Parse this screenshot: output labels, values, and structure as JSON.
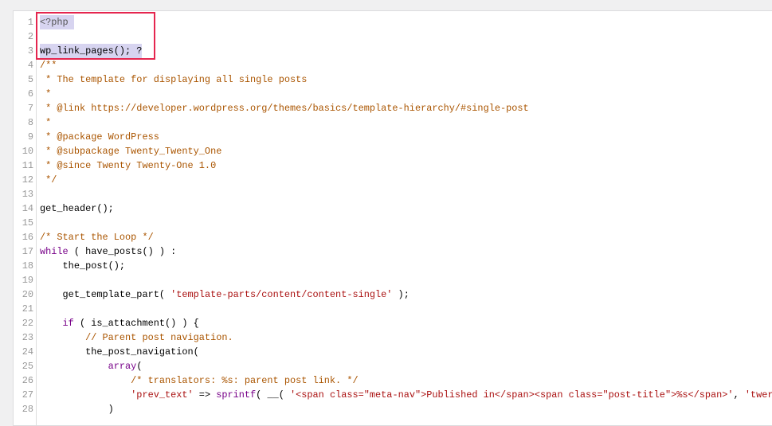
{
  "editor": {
    "highlight_color": "#e5264f",
    "selection_color": "#d7d4f0",
    "lines": [
      {
        "n": "1",
        "sel": true,
        "tokens": [
          [
            "<?php ",
            "meta"
          ]
        ]
      },
      {
        "n": "2",
        "sel": false,
        "tokens": []
      },
      {
        "n": "3",
        "sel": true,
        "tokens": [
          [
            "wp_link_pages(); ?",
            "plain"
          ]
        ]
      },
      {
        "n": "4",
        "tokens": [
          [
            "/**",
            "comment"
          ]
        ]
      },
      {
        "n": "5",
        "tokens": [
          [
            " * The template for displaying all single posts",
            "comment"
          ]
        ]
      },
      {
        "n": "6",
        "tokens": [
          [
            " *",
            "comment"
          ]
        ]
      },
      {
        "n": "7",
        "tokens": [
          [
            " * @link https://developer.wordpress.org/themes/basics/template-hierarchy/#single-post",
            "comment"
          ]
        ]
      },
      {
        "n": "8",
        "tokens": [
          [
            " *",
            "comment"
          ]
        ]
      },
      {
        "n": "9",
        "tokens": [
          [
            " * @package WordPress",
            "comment"
          ]
        ]
      },
      {
        "n": "10",
        "tokens": [
          [
            " * @subpackage Twenty_Twenty_One",
            "comment"
          ]
        ]
      },
      {
        "n": "11",
        "tokens": [
          [
            " * @since Twenty Twenty-One 1.0",
            "comment"
          ]
        ]
      },
      {
        "n": "12",
        "tokens": [
          [
            " */",
            "comment"
          ]
        ]
      },
      {
        "n": "13",
        "tokens": []
      },
      {
        "n": "14",
        "tokens": [
          [
            "get_header();",
            "plain"
          ]
        ]
      },
      {
        "n": "15",
        "tokens": []
      },
      {
        "n": "16",
        "tokens": [
          [
            "/* Start the Loop */",
            "comment"
          ]
        ]
      },
      {
        "n": "17",
        "tokens": [
          [
            "while",
            "keyword"
          ],
          [
            " ( have_posts() ) :",
            "plain"
          ]
        ]
      },
      {
        "n": "18",
        "tokens": [
          [
            "    the_post();",
            "plain"
          ]
        ]
      },
      {
        "n": "19",
        "tokens": []
      },
      {
        "n": "20",
        "tokens": [
          [
            "    get_template_part( ",
            "plain"
          ],
          [
            "'template-parts/content/content-single'",
            "string"
          ],
          [
            " );",
            "plain"
          ]
        ]
      },
      {
        "n": "21",
        "tokens": []
      },
      {
        "n": "22",
        "tokens": [
          [
            "    ",
            "plain"
          ],
          [
            "if",
            "keyword"
          ],
          [
            " ( is_attachment() ) {",
            "plain"
          ]
        ]
      },
      {
        "n": "23",
        "tokens": [
          [
            "        // Parent post navigation.",
            "comment"
          ]
        ]
      },
      {
        "n": "24",
        "tokens": [
          [
            "        the_post_navigation(",
            "plain"
          ]
        ]
      },
      {
        "n": "25",
        "tokens": [
          [
            "            ",
            "plain"
          ],
          [
            "array",
            "keyword"
          ],
          [
            "(",
            "plain"
          ]
        ]
      },
      {
        "n": "26",
        "tokens": [
          [
            "                /* translators: %s: parent post link. */",
            "comment"
          ]
        ]
      },
      {
        "n": "27",
        "tokens": [
          [
            "                ",
            "plain"
          ],
          [
            "'prev_text'",
            "string"
          ],
          [
            " => ",
            "plain"
          ],
          [
            "sprintf",
            "keyword"
          ],
          [
            "( __( ",
            "plain"
          ],
          [
            "'<span class=\"meta-nav\">Published in</span><span class=\"post-title\">%s</span>'",
            "string"
          ],
          [
            ", ",
            "plain"
          ],
          [
            "'twer",
            "string"
          ]
        ]
      },
      {
        "n": "28",
        "tokens": [
          [
            "            )",
            "plain"
          ]
        ]
      }
    ]
  }
}
